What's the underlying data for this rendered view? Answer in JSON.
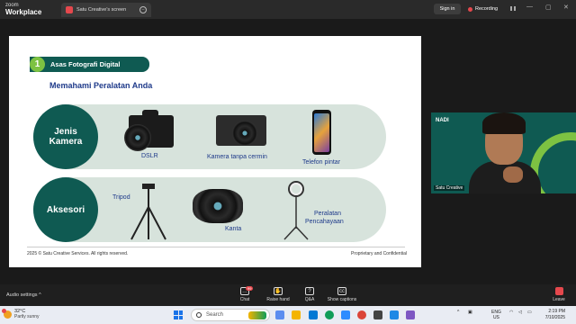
{
  "titlebar": {
    "brand_top": "zoom",
    "brand_bottom": "Workplace",
    "tab_label": "Satu Creative's screen",
    "signin_label": "Sign in",
    "recording_label": "Recording"
  },
  "slide": {
    "badge_number": "1",
    "badge_title": "Asas Fotografi Digital",
    "subtitle": "Memahami Peralatan Anda",
    "row1_title": "Jenis Kamera",
    "row2_title": "Aksesori",
    "items": {
      "dslr": "DSLR",
      "mirrorless": "Kamera tanpa cermin",
      "phone": "Telefon pintar",
      "tripod": "Tripod",
      "lens": "Kanta",
      "lighting_line1": "Peralatan",
      "lighting_line2": "Pencahayaan"
    },
    "footer_left": "2025 © Satu Creative Services. All rights reserved.",
    "footer_right": "Proprietary and Confidential"
  },
  "participant": {
    "overlay_label": "NADI",
    "name": "Satu Creative"
  },
  "toolbar": {
    "audio_settings": "Audio settings",
    "chat": "Chat",
    "chat_badge": "99",
    "raise_hand": "Raise hand",
    "qa": "Q&A",
    "captions": "Show captions",
    "leave": "Leave"
  },
  "taskbar": {
    "temperature": "32°C",
    "weather": "Partly sunny",
    "search_placeholder": "Search",
    "lang_top": "ENG",
    "lang_bottom": "US",
    "time": "2:19 PM",
    "date": "7/10/2025"
  },
  "colors": {
    "teal": "#0f5a52",
    "green": "#7dc242",
    "navy": "#1e3a8a",
    "band": "#d7e3dc",
    "record_red": "#e5484d"
  }
}
